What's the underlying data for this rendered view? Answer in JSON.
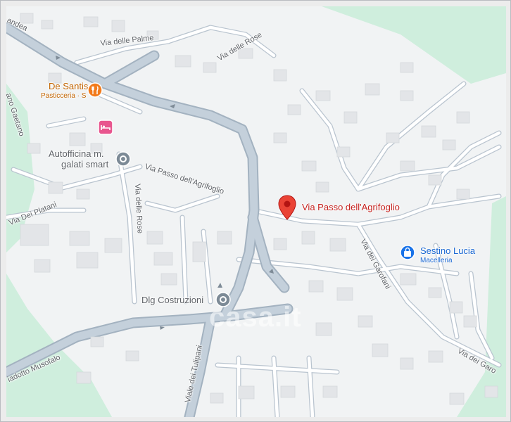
{
  "map": {
    "pin_label": "Via Passo dell'Agrifoglio",
    "streets": {
      "andea": "andea",
      "via_delle_palme": "Via delle Palme",
      "via_delle_rose_top": "Via delle Rose",
      "via_delle_rose_left": "Via delle Rose",
      "gaetano": "ano Gaetano",
      "via_passo_agrifoglio": "Via Passo dell'Agrifoglio",
      "via_dei_platani": "Via Dei Platani",
      "via_dei_garofani": "Via dei Garofani",
      "via_dei_garo_right": "Via dei Garo",
      "viale_dei_tulipani": "Viale dei Tulipani",
      "viadotto_musofalo": "iadotto Musofalo"
    },
    "pois": {
      "de_santis": {
        "name": "De Santis",
        "category": "Pasticceria · S",
        "icon": "restaurant-icon",
        "color": "#f27b1c"
      },
      "hotel": {
        "icon": "hotel-icon",
        "color": "#e8558e"
      },
      "autofficina": {
        "name": "Autofficina m.",
        "name2": "galati smart",
        "icon": "generic-poi-icon",
        "color": "#7c8a96"
      },
      "dlg": {
        "name": "Dlg Costruzioni",
        "icon": "generic-poi-icon",
        "color": "#7c8a96"
      },
      "sestino": {
        "name": "Sestino Lucia",
        "category": "Macelleria",
        "icon": "shopping-bag-icon",
        "color": "#1a73e8"
      }
    },
    "pin_color": "#ea4335",
    "watermark": "casa.it"
  }
}
